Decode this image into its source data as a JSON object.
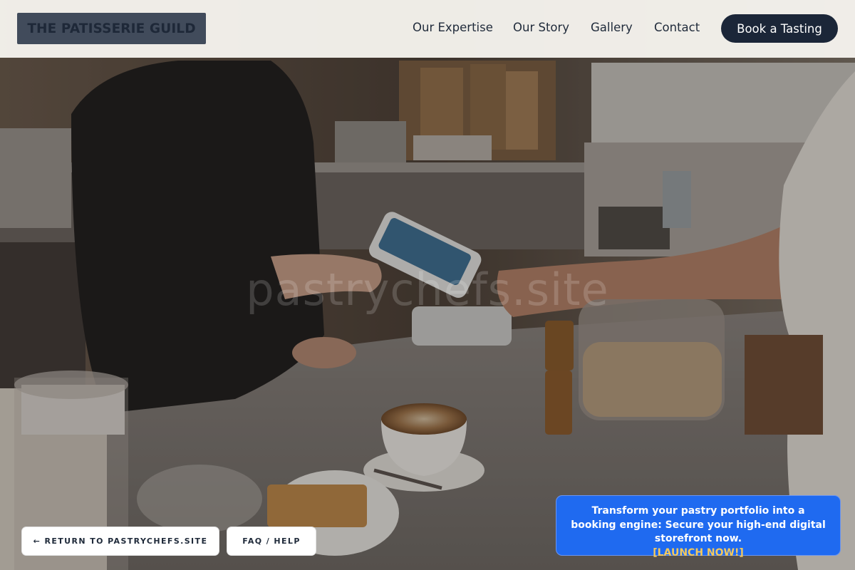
{
  "header": {
    "logo_text": "THE PATISSERIE GUILD",
    "nav": [
      {
        "label": "Our Expertise"
      },
      {
        "label": "Our Story"
      },
      {
        "label": "Gallery"
      },
      {
        "label": "Contact"
      }
    ],
    "cta_label": "Book a Tasting"
  },
  "hero": {
    "watermark": "pastrychefs.site"
  },
  "footer_buttons": {
    "return_label": "← RETURN TO PASTRYCHEFS.SITE",
    "faq_label": "FAQ / HELP"
  },
  "promo": {
    "text": "Transform your pastry portfolio into a booking engine: Secure your high-end digital storefront now.",
    "link_label": "[LAUNCH NOW!]"
  },
  "colors": {
    "header_bg": "#f6f4ee",
    "logo_bg": "#414b5b",
    "cta_bg": "#1b2638",
    "promo_bg": "#1f6af0",
    "promo_link": "#f4c95c"
  }
}
